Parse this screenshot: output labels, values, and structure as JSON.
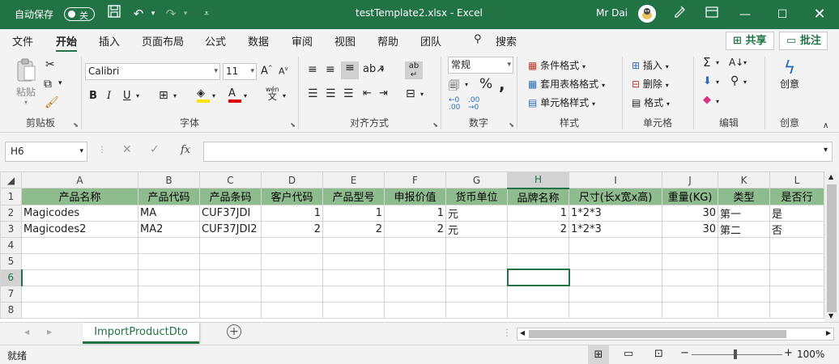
{
  "titlebar": {
    "autosave_label": "自动保存",
    "autosave_state": "关",
    "doc_title": "testTemplate2.xlsx  -  Excel",
    "user": "Mr Dai"
  },
  "menu": {
    "items": [
      "文件",
      "开始",
      "插入",
      "页面布局",
      "公式",
      "数据",
      "审阅",
      "视图",
      "帮助",
      "团队"
    ],
    "search": "搜索",
    "share": "共享",
    "comments": "批注"
  },
  "ribbon": {
    "clipboard": {
      "paste": "粘贴",
      "label": "剪贴板"
    },
    "font": {
      "name": "Calibri",
      "size": "11",
      "label": "字体",
      "wen": "wén",
      "wen2": "文"
    },
    "alignment": {
      "label": "对齐方式"
    },
    "number": {
      "format": "常规",
      "label": "数字"
    },
    "styles": {
      "conditional": "条件格式",
      "table": "套用表格格式",
      "cell": "单元格样式",
      "label": "样式"
    },
    "cells": {
      "insert": "插入",
      "delete": "删除",
      "format": "格式",
      "label": "单元格"
    },
    "editing": {
      "label": "编辑"
    },
    "creativity": {
      "create": "创意",
      "label": "创意"
    }
  },
  "formula_bar": {
    "name_box": "H6",
    "fx": "fx",
    "value": ""
  },
  "sheet": {
    "columns": [
      "A",
      "B",
      "C",
      "D",
      "E",
      "F",
      "G",
      "H",
      "I",
      "J",
      "K",
      "L"
    ],
    "header_row": [
      "产品名称",
      "产品代码",
      "产品条码",
      "客户代码",
      "产品型号",
      "申报价值",
      "货币单位",
      "品牌名称",
      "尺寸(长x宽x高)",
      "重量(KG)",
      "类型",
      "是否行"
    ],
    "rows": [
      [
        "Magicodes",
        "MA",
        "CUF37JDI",
        "1",
        "1",
        "1",
        "元",
        "1",
        "1*2*3",
        "30",
        "第一",
        "是"
      ],
      [
        "Magicodes2",
        "MA2",
        "CUF37JDI2",
        "2",
        "2",
        "2",
        "元",
        "2",
        "1*2*3",
        "30",
        "第二",
        "否"
      ]
    ],
    "row_numbers": [
      "1",
      "2",
      "3",
      "4",
      "5",
      "6",
      "7",
      "8"
    ]
  },
  "tabs": {
    "active": "ImportProductDto"
  },
  "status": {
    "ready": "就绪",
    "zoom": "100%"
  },
  "colors": {
    "accent": "#217346",
    "header_fill": "#8fbc8f"
  }
}
